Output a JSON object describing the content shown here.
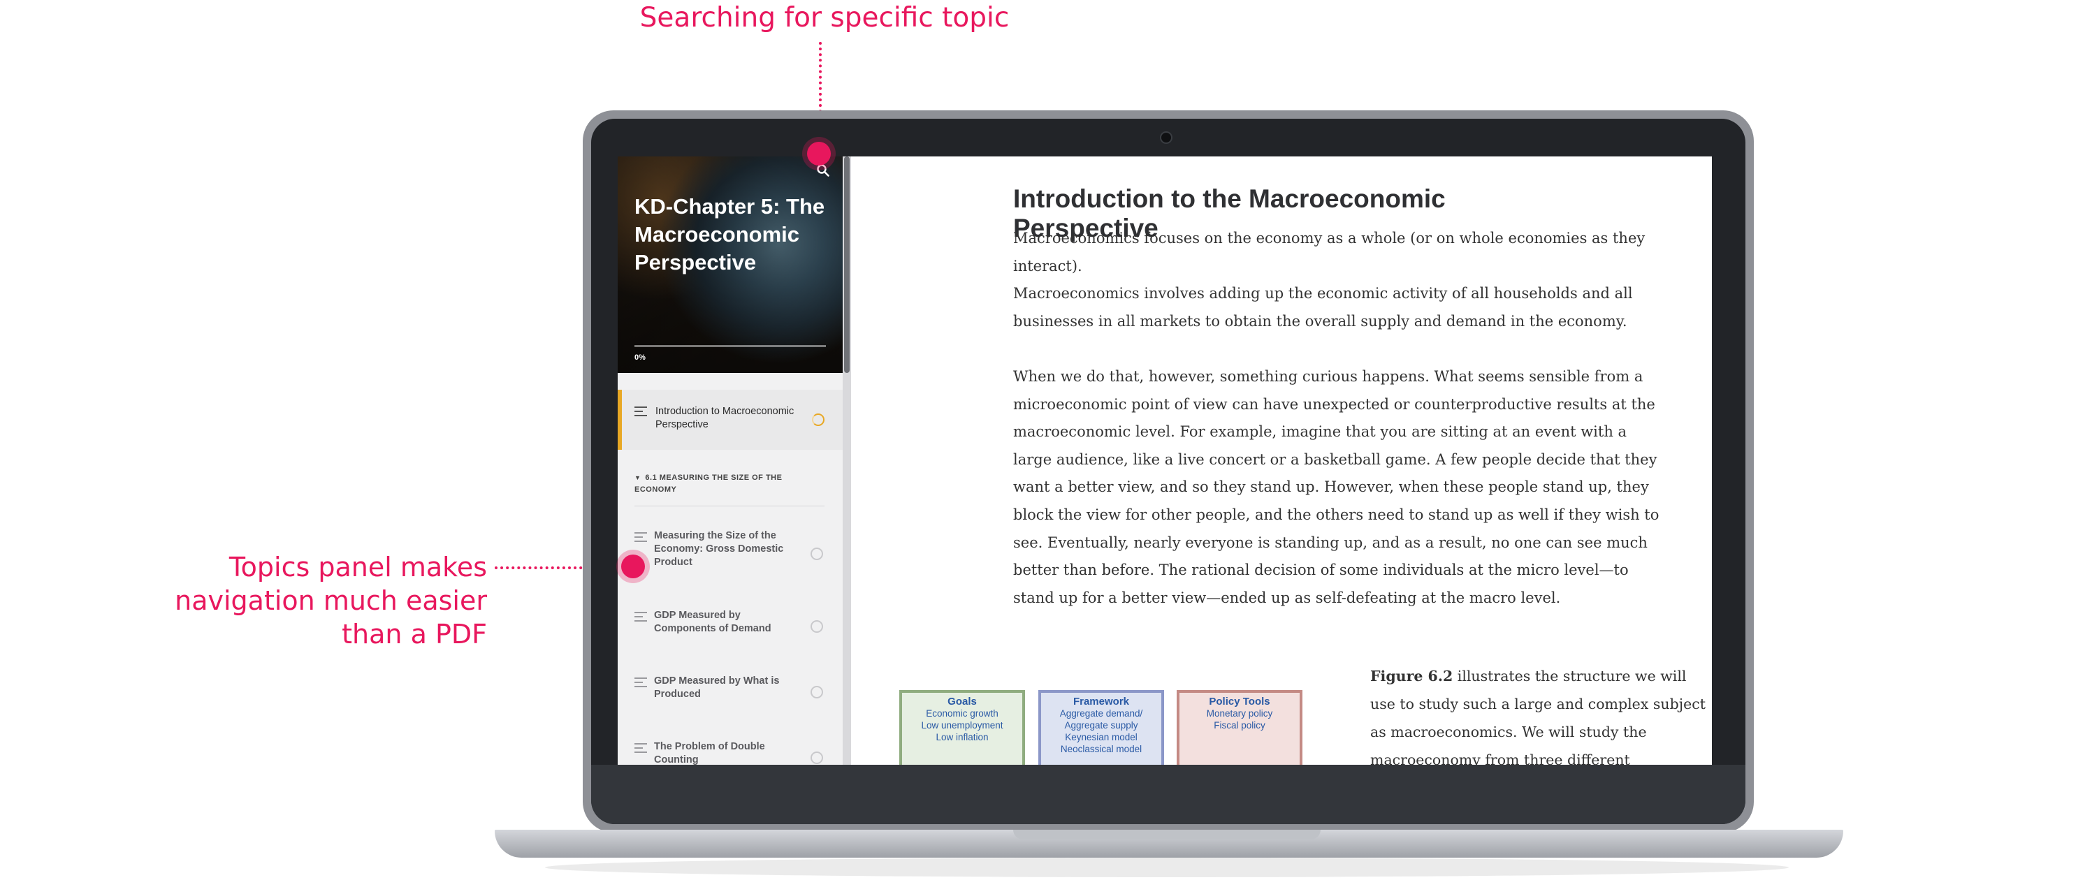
{
  "callouts": {
    "search": "Searching for specific topic",
    "topics_line1": "Topics panel makes",
    "topics_line2": "navigation much easier",
    "topics_line3": "than a PDF"
  },
  "sidebar": {
    "course_title": "KD-Chapter 5: The Macroeconomic Perspective",
    "progress": "0%",
    "progress_fraction": 0,
    "search_icon": "search-icon",
    "lessons": [
      {
        "label": "Introduction to Macroeconomic Perspective",
        "status": "in-progress"
      },
      {
        "label": "Measuring the Size of the Economy: Gross Domestic Product",
        "status": "not-started"
      },
      {
        "label": "GDP Measured by Components of Demand",
        "status": "not-started"
      },
      {
        "label": "GDP Measured by What is Produced",
        "status": "not-started"
      },
      {
        "label": "The Problem of Double Counting",
        "status": "not-started"
      }
    ],
    "section_heading": "6.1 MEASURING THE SIZE OF THE ECONOMY"
  },
  "content": {
    "title": "Introduction to the Macroeconomic Perspective",
    "para1": "Macroeconomics focuses on the economy as a whole (or on whole economies as they interact).",
    "para2": "Macroeconomics involves adding up the economic activity of all households and all businesses in all markets to obtain the overall supply and demand in the economy.",
    "para3": "When we do that, however, something curious happens. What seems sensible from a microeconomic point of view can have unexpected or counterproductive results at the macroeconomic level. For example, imagine that you are sitting at an event with a large audience, like a live concert or a basketball game. A few people decide that they want a better view, and so they stand up. However, when these people stand up, they block the view for other people, and the others need to stand up as well if they wish to see. Eventually, nearly everyone is standing up, and as a result, no one can see much better than before. The rational decision of some individuals at the micro level—to stand up for a better view—ended up as self-defeating at the macro level.",
    "figure_ref": "Figure 6.2",
    "figure_text": "illustrates the structure we will use to study such a large and complex subject as macroeconomics. We will study the macroeconomy from three different",
    "figure_boxes": {
      "goals": {
        "title": "Goals",
        "lines": [
          "Economic growth",
          "Low unemployment",
          "Low inflation"
        ]
      },
      "framework": {
        "title": "Framework",
        "lines": [
          "Aggregate demand/",
          "Aggregate supply",
          "Keynesian model",
          "Neoclassical model"
        ]
      },
      "tools": {
        "title": "Policy Tools",
        "lines": [
          "Monetary policy",
          "Fiscal policy"
        ]
      }
    }
  },
  "colors": {
    "accent": "#e8175d",
    "lesson_active": "#e8a825"
  }
}
